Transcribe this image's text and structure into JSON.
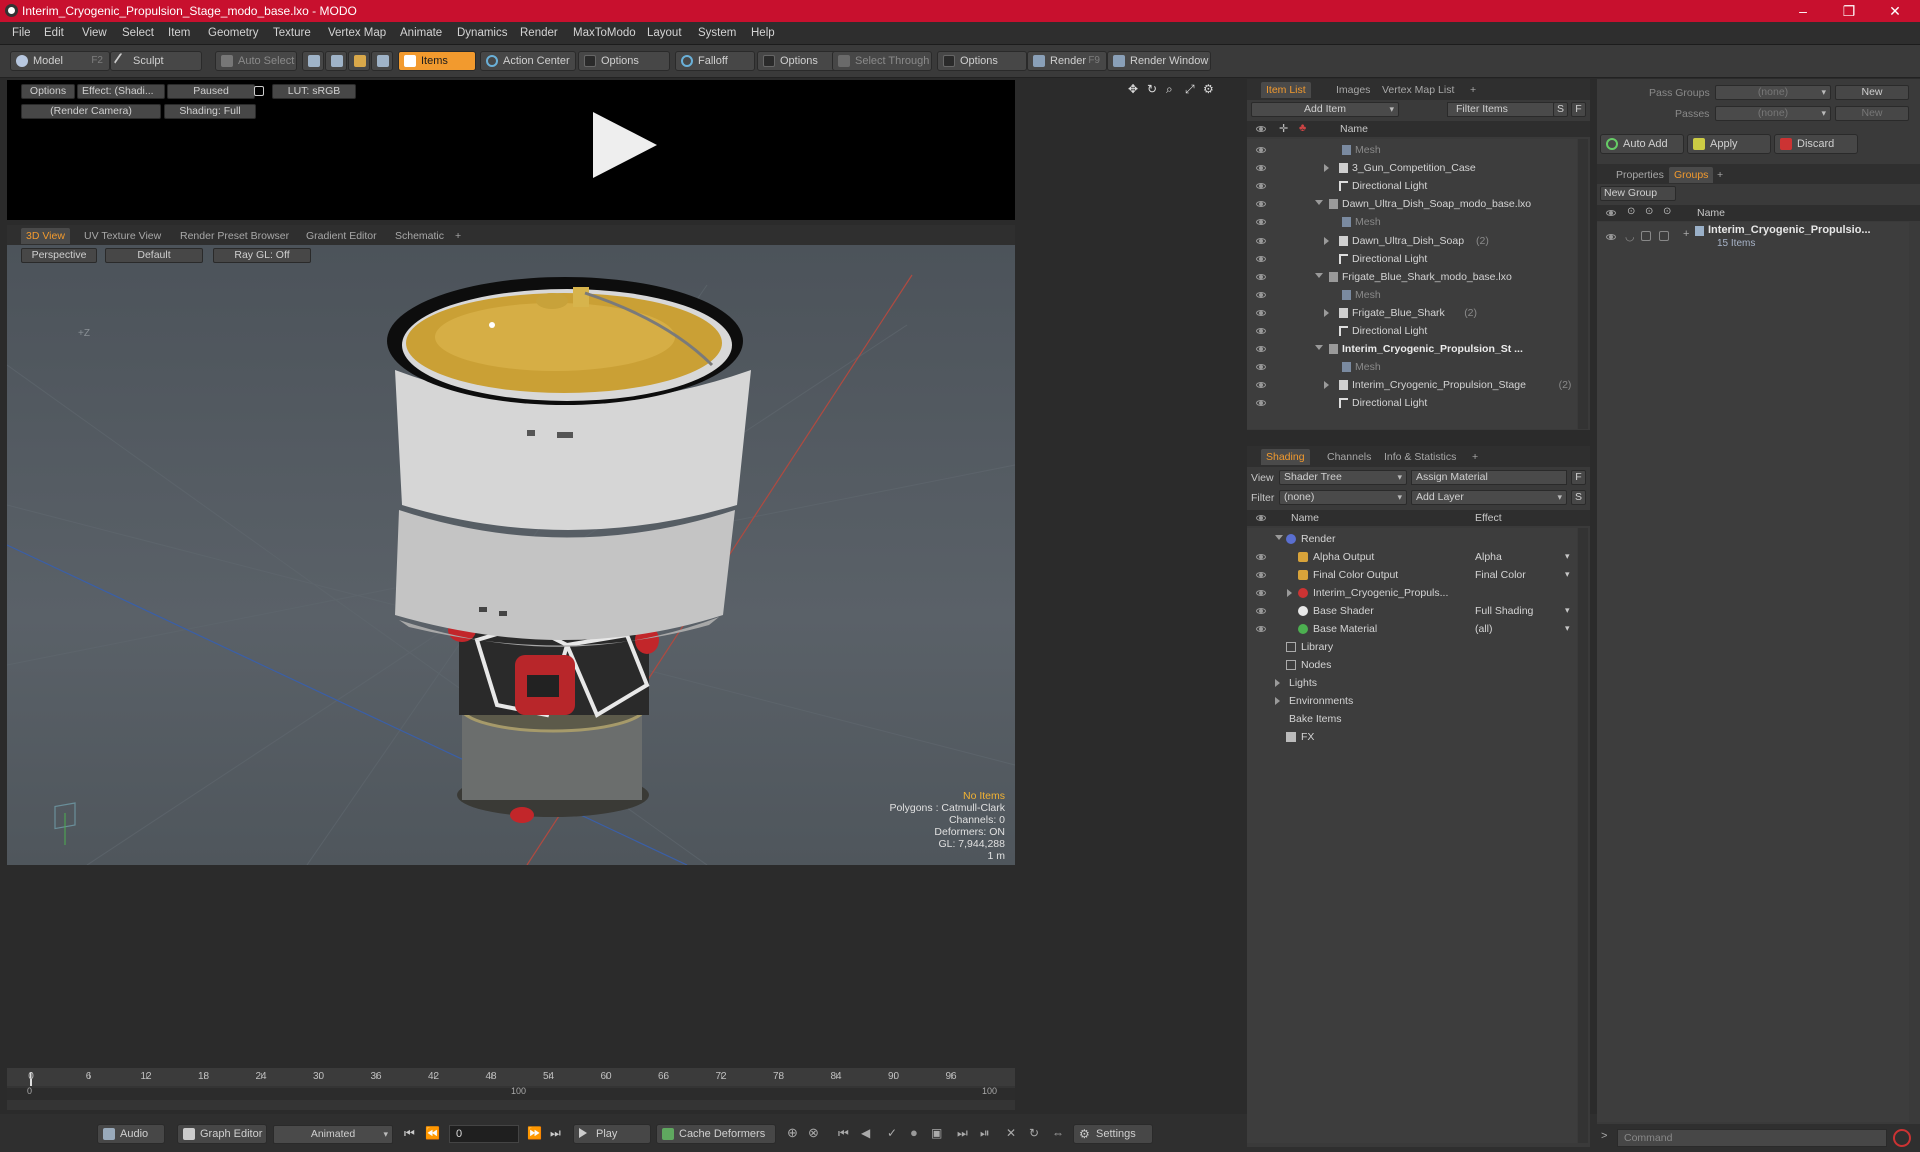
{
  "window": {
    "title": "Interim_Cryogenic_Propulsion_Stage_modo_base.lxo - MODO",
    "controls": [
      "–",
      "❐",
      "✕"
    ]
  },
  "menubar": [
    "File",
    "Edit",
    "View",
    "Select",
    "Item",
    "Geometry",
    "Texture",
    "Vertex Map",
    "Animate",
    "Dynamics",
    "Render",
    "MaxToModo",
    "Layout",
    "System",
    "Help"
  ],
  "toolbar": {
    "model": "Model",
    "model_hotkey": "F2",
    "sculpt": "Sculpt",
    "auto_select": "Auto Select",
    "items": "Items",
    "action_center": "Action Center",
    "options1": "Options",
    "falloff": "Falloff",
    "options2": "Options",
    "select_through": "Select Through",
    "options3": "Options",
    "render": "Render",
    "render_hotkey": "F9",
    "render_window": "Render Window"
  },
  "preview": {
    "options": "Options",
    "effect": "Effect: (Shadi...",
    "paused": "Paused",
    "lut": "LUT: sRGB",
    "camera": "(Render Camera)",
    "shading": "Shading: Full"
  },
  "viewport_tabs": [
    "3D View",
    "UV Texture View",
    "Render Preset Browser",
    "Gradient Editor",
    "Schematic"
  ],
  "viewport": {
    "perspective": "Perspective",
    "default": "Default",
    "raygl": "Ray GL: Off",
    "axis_label": "+Z",
    "hud": {
      "no_items": "No Items",
      "polygons": "Polygons : Catmull-Clark",
      "channels": "Channels: 0",
      "deformers": "Deformers: ON",
      "gl": "GL: 7,944,288",
      "scale": "1 m"
    }
  },
  "timeline": {
    "ticks": [
      "0",
      "6",
      "12",
      "18",
      "24",
      "30",
      "36",
      "42",
      "48",
      "54",
      "60",
      "66",
      "72",
      "78",
      "84",
      "90",
      "96"
    ],
    "range_start": "0",
    "range_end": "100",
    "range_mid": "100"
  },
  "transport": {
    "audio": "Audio",
    "graph_editor": "Graph Editor",
    "animated": "Animated",
    "frame": "0",
    "play": "Play",
    "cache_deformers": "Cache Deformers",
    "settings": "Settings"
  },
  "item_list": {
    "tabs": [
      "Item List",
      "Images",
      "Vertex Map List"
    ],
    "add_item": "Add Item",
    "filter_items": "Filter Items",
    "s": "S",
    "f": "F",
    "header_name": "Name",
    "rows": [
      {
        "label": "Mesh",
        "indent": 3,
        "type": "mesh",
        "expand": "",
        "count": ""
      },
      {
        "label": "3_Gun_Competition_Case",
        "indent": 2,
        "type": "group",
        "expand": "r",
        "count": ""
      },
      {
        "label": "Directional Light",
        "indent": 2,
        "type": "light",
        "expand": "",
        "count": ""
      },
      {
        "label": "Dawn_Ultra_Dish_Soap_modo_base.lxo",
        "indent": 1,
        "type": "scene",
        "expand": "d",
        "count": ""
      },
      {
        "label": "Mesh",
        "indent": 3,
        "type": "mesh",
        "expand": "",
        "count": ""
      },
      {
        "label": "Dawn_Ultra_Dish_Soap",
        "indent": 2,
        "type": "group",
        "expand": "r",
        "count": "(2)"
      },
      {
        "label": "Directional Light",
        "indent": 2,
        "type": "light",
        "expand": "",
        "count": ""
      },
      {
        "label": "Frigate_Blue_Shark_modo_base.lxo",
        "indent": 1,
        "type": "scene",
        "expand": "d",
        "count": ""
      },
      {
        "label": "Mesh",
        "indent": 3,
        "type": "mesh",
        "expand": "",
        "count": ""
      },
      {
        "label": "Frigate_Blue_Shark",
        "indent": 2,
        "type": "group",
        "expand": "r",
        "count": "(2)"
      },
      {
        "label": "Directional Light",
        "indent": 2,
        "type": "light",
        "expand": "",
        "count": ""
      },
      {
        "label": "Interim_Cryogenic_Propulsion_St ...",
        "indent": 1,
        "type": "scene",
        "expand": "d",
        "count": "",
        "bold": true
      },
      {
        "label": "Mesh",
        "indent": 3,
        "type": "mesh",
        "expand": "",
        "count": ""
      },
      {
        "label": "Interim_Cryogenic_Propulsion_Stage",
        "indent": 2,
        "type": "group",
        "expand": "r",
        "count": "(2)"
      },
      {
        "label": "Directional Light",
        "indent": 2,
        "type": "light",
        "expand": "",
        "count": ""
      }
    ]
  },
  "shading": {
    "tabs": [
      "Shading",
      "Channels",
      "Info & Statistics"
    ],
    "view_label": "View",
    "view_value": "Shader Tree",
    "assign_material": "Assign Material",
    "filter_label": "Filter",
    "filter_value": "(none)",
    "add_layer": "Add Layer",
    "f": "F",
    "s": "S",
    "header_name": "Name",
    "header_effect": "Effect",
    "rows": [
      {
        "label": "Render",
        "indent": 0,
        "expand": "d",
        "effect": "",
        "eye": false,
        "icon": "render"
      },
      {
        "label": "Alpha Output",
        "indent": 1,
        "expand": "",
        "effect": "Alpha",
        "eye": true,
        "icon": "output"
      },
      {
        "label": "Final Color Output",
        "indent": 1,
        "expand": "",
        "effect": "Final Color",
        "eye": true,
        "icon": "output"
      },
      {
        "label": "Interim_Cryogenic_Propuls...",
        "indent": 1,
        "expand": "r",
        "effect": "",
        "eye": true,
        "icon": "material"
      },
      {
        "label": "Base Shader",
        "indent": 1,
        "expand": "",
        "effect": "Full Shading",
        "eye": true,
        "icon": "shader"
      },
      {
        "label": "Base Material",
        "indent": 1,
        "expand": "",
        "effect": "(all)",
        "eye": true,
        "icon": "basemat"
      },
      {
        "label": "Library",
        "indent": 0,
        "expand": "",
        "effect": "",
        "eye": false,
        "icon": "folder"
      },
      {
        "label": "Nodes",
        "indent": 0,
        "expand": "",
        "effect": "",
        "eye": false,
        "icon": "folder"
      },
      {
        "label": "Lights",
        "indent": -1,
        "expand": "r",
        "effect": "",
        "eye": false,
        "icon": "none"
      },
      {
        "label": "Environments",
        "indent": -1,
        "expand": "r",
        "effect": "",
        "eye": false,
        "icon": "none"
      },
      {
        "label": "Bake Items",
        "indent": -1,
        "expand": "",
        "effect": "",
        "eye": false,
        "icon": "none"
      },
      {
        "label": "FX",
        "indent": 0,
        "expand": "",
        "effect": "",
        "eye": false,
        "icon": "fx"
      }
    ]
  },
  "groups_panel": {
    "pass_groups_label": "Pass Groups",
    "pass_groups_value": "(none)",
    "passes_label": "Passes",
    "passes_value": "(none)",
    "new1": "New",
    "new2": "New",
    "auto_add": "Auto Add",
    "apply": "Apply",
    "discard": "Discard",
    "tabs": [
      "Properties",
      "Groups"
    ],
    "new_group": "New Group",
    "header_name": "Name",
    "group_name": "Interim_Cryogenic_Propulsio...",
    "group_count": "15 Items",
    "command_placeholder": "Command"
  },
  "colors": {
    "accent": "#f29a2e",
    "titlebar": "#c8102e",
    "hud_warning": "#f2b233"
  }
}
